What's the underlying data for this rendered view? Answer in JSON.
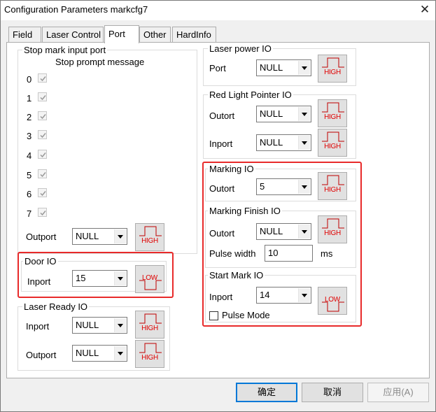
{
  "window": {
    "title": "Configuration Parameters markcfg7",
    "close_glyph": "✕"
  },
  "tabs": [
    {
      "label": "Field"
    },
    {
      "label": "Laser Control"
    },
    {
      "label": "Port"
    },
    {
      "label": "Other"
    },
    {
      "label": "HardInfo"
    }
  ],
  "stop_mark": {
    "title": "Stop mark input port",
    "subtitle": "Stop prompt message",
    "ports": [
      {
        "label": "0",
        "checked": true
      },
      {
        "label": "1",
        "checked": true
      },
      {
        "label": "2",
        "checked": true
      },
      {
        "label": "3",
        "checked": true
      },
      {
        "label": "4",
        "checked": true
      },
      {
        "label": "5",
        "checked": true
      },
      {
        "label": "6",
        "checked": true
      },
      {
        "label": "7",
        "checked": true
      }
    ],
    "outport_label": "Outport",
    "outport_value": "NULL",
    "outport_level": "HIGH"
  },
  "door_io": {
    "title": "Door IO",
    "inport_label": "Inport",
    "inport_value": "15",
    "inport_level": "LOW"
  },
  "laser_ready_io": {
    "title": "Laser Ready IO",
    "inport_label": "Inport",
    "inport_value": "NULL",
    "inport_level": "HIGH",
    "outport_label": "Outport",
    "outport_value": "NULL",
    "outport_level": "HIGH"
  },
  "laser_power_io": {
    "title": "Laser power IO",
    "port_label": "Port",
    "port_value": "NULL",
    "port_level": "HIGH"
  },
  "red_light_pointer_io": {
    "title": "Red Light Pointer IO",
    "outort_label": "Outort",
    "outort_value": "NULL",
    "outort_level": "HIGH",
    "inport_label": "Inport",
    "inport_value": "NULL",
    "inport_level": "HIGH"
  },
  "marking_io": {
    "title": "Marking IO",
    "outort_label": "Outort",
    "outort_value": "5",
    "outort_level": "HIGH"
  },
  "marking_finish_io": {
    "title": "Marking Finish IO",
    "outort_label": "Outort",
    "outort_value": "NULL",
    "outort_level": "HIGH",
    "pulse_width_label": "Pulse width",
    "pulse_width_value": "10",
    "pulse_width_unit": "ms"
  },
  "start_mark_io": {
    "title": "Start Mark IO",
    "inport_label": "Inport",
    "inport_value": "14",
    "inport_level": "LOW",
    "pulse_mode_label": "Pulse Mode",
    "pulse_mode_checked": false
  },
  "buttons": {
    "ok": "确定",
    "cancel": "取消",
    "apply": "应用(A)"
  },
  "colors": {
    "highlight": "#e82a2a",
    "level_text": "#e00000",
    "default_button_border": "#0078d7"
  }
}
